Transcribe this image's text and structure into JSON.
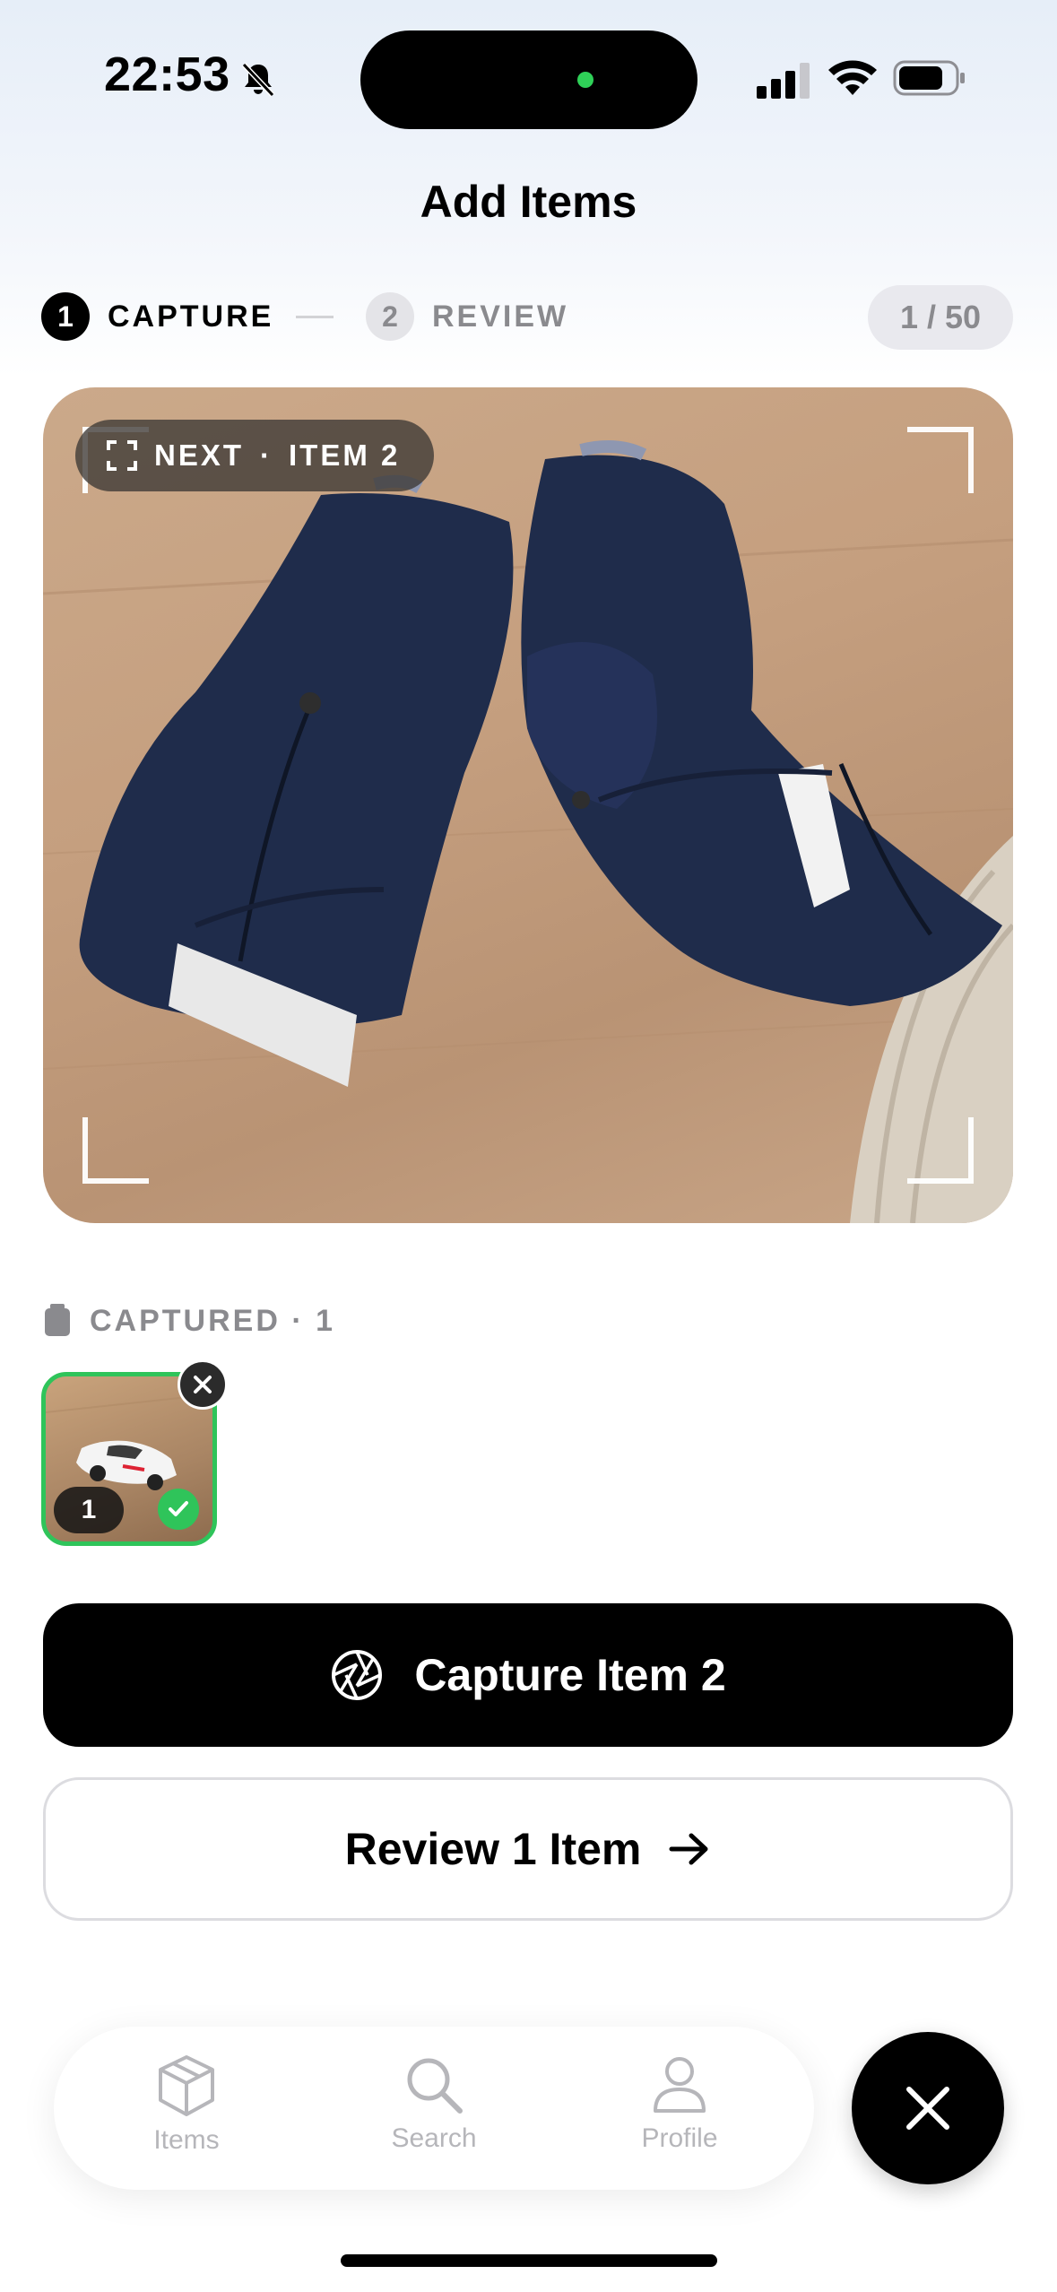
{
  "status_bar": {
    "time": "22:53",
    "icons": [
      "bell-slash-icon",
      "cellular-signal-icon",
      "wifi-icon",
      "battery-icon"
    ]
  },
  "header": {
    "title": "Add Items"
  },
  "stepper": {
    "steps": [
      {
        "number": "1",
        "label": "CAPTURE",
        "active": true
      },
      {
        "number": "2",
        "label": "REVIEW",
        "active": false
      }
    ],
    "counter": "1 / 50"
  },
  "camera": {
    "hint_prefix": "NEXT",
    "hint_separator": "·",
    "hint_item": "ITEM 2",
    "hint_icon": "viewfinder-icon"
  },
  "captured": {
    "label": "CAPTURED · 1",
    "items": [
      {
        "number": "1",
        "status": "done"
      }
    ]
  },
  "actions": {
    "capture_label": "Capture Item 2",
    "capture_icon": "aperture-icon",
    "review_label": "Review 1 Item",
    "review_icon": "arrow-right-icon"
  },
  "tabbar": {
    "items": [
      {
        "label": "Items",
        "icon": "box-icon"
      },
      {
        "label": "Search",
        "icon": "search-icon"
      },
      {
        "label": "Profile",
        "icon": "person-icon"
      }
    ],
    "fab_icon": "close-icon"
  },
  "colors": {
    "accent_green": "#2fc45a",
    "primary": "#000000",
    "muted": "#8a8a8e"
  }
}
